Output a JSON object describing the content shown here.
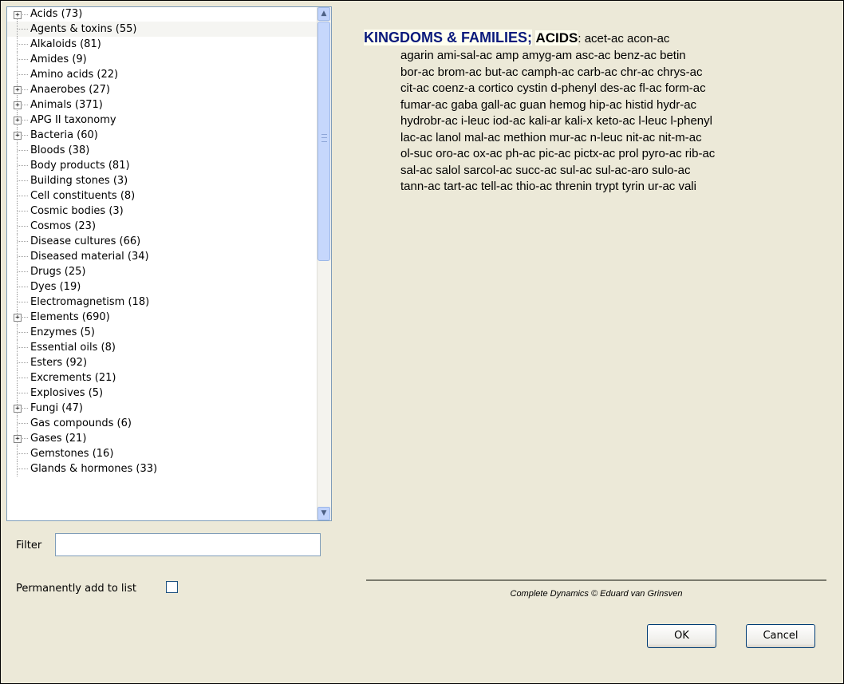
{
  "tree": {
    "items": [
      {
        "label": "Acids (73)",
        "expandable": true
      },
      {
        "label": "Agents & toxins (55)",
        "expandable": false
      },
      {
        "label": "Alkaloids (81)",
        "expandable": false
      },
      {
        "label": "Amides (9)",
        "expandable": false
      },
      {
        "label": "Amino acids (22)",
        "expandable": false
      },
      {
        "label": "Anaerobes (27)",
        "expandable": true
      },
      {
        "label": "Animals (371)",
        "expandable": true
      },
      {
        "label": "APG II taxonomy",
        "expandable": true
      },
      {
        "label": "Bacteria (60)",
        "expandable": true
      },
      {
        "label": "Bloods (38)",
        "expandable": false
      },
      {
        "label": "Body products (81)",
        "expandable": false
      },
      {
        "label": "Building stones (3)",
        "expandable": false
      },
      {
        "label": "Cell constituents (8)",
        "expandable": false
      },
      {
        "label": "Cosmic bodies (3)",
        "expandable": false
      },
      {
        "label": "Cosmos (23)",
        "expandable": false
      },
      {
        "label": "Disease cultures (66)",
        "expandable": false
      },
      {
        "label": "Diseased material (34)",
        "expandable": false
      },
      {
        "label": "Drugs (25)",
        "expandable": false
      },
      {
        "label": "Dyes (19)",
        "expandable": false
      },
      {
        "label": "Electromagnetism (18)",
        "expandable": false
      },
      {
        "label": "Elements (690)",
        "expandable": true
      },
      {
        "label": "Enzymes (5)",
        "expandable": false
      },
      {
        "label": "Essential oils (8)",
        "expandable": false
      },
      {
        "label": "Esters (92)",
        "expandable": false
      },
      {
        "label": "Excrements (21)",
        "expandable": false
      },
      {
        "label": "Explosives (5)",
        "expandable": false
      },
      {
        "label": "Fungi (47)",
        "expandable": true
      },
      {
        "label": "Gas compounds (6)",
        "expandable": false
      },
      {
        "label": "Gases (21)",
        "expandable": true
      },
      {
        "label": "Gemstones (16)",
        "expandable": false
      },
      {
        "label": "Glands & hormones (33)",
        "expandable": false
      }
    ],
    "expand_symbol": "+",
    "scroll_up_symbol": "▲",
    "scroll_down_symbol": "▼"
  },
  "filter": {
    "label": "Filter",
    "value": ""
  },
  "permanent": {
    "label": "Permanently add to list",
    "checked": false
  },
  "content": {
    "kingdoms": "KINGDOMS & FAMILIES;",
    "acids": "ACIDS",
    "first_line": ": acet-ac acon-ac",
    "lines": [
      "agarin ami-sal-ac amp amyg-am asc-ac benz-ac betin",
      "bor-ac brom-ac but-ac camph-ac carb-ac chr-ac chrys-ac",
      "cit-ac coenz-a cortico cystin d-phenyl des-ac fl-ac form-ac",
      "fumar-ac gaba gall-ac guan hemog hip-ac histid hydr-ac",
      "hydrobr-ac i-leuc iod-ac kali-ar kali-x keto-ac l-leuc l-phenyl",
      "lac-ac lanol mal-ac methion mur-ac n-leuc nit-ac nit-m-ac",
      "ol-suc oro-ac ox-ac ph-ac pic-ac pictx-ac prol pyro-ac rib-ac",
      "sal-ac salol sarcol-ac succ-ac sul-ac sul-ac-aro sulo-ac",
      "tann-ac tart-ac tell-ac thio-ac threnin trypt tyrin ur-ac vali"
    ]
  },
  "footer": {
    "text": "Complete Dynamics © Eduard van Grinsven"
  },
  "buttons": {
    "ok": "OK",
    "cancel": "Cancel"
  }
}
